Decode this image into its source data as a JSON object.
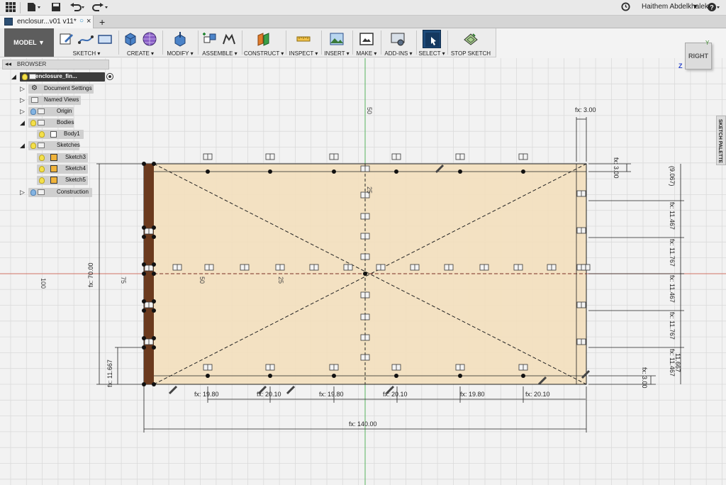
{
  "app": {
    "user_name": "Haithem Abdelkhalek",
    "document_tab": "enclosur...v01 v11*",
    "new_tab": "+",
    "help": "?"
  },
  "icons": {
    "app_grid": "app-grid-icon",
    "file": "file-icon",
    "save": "save-icon",
    "undo": "undo-icon",
    "redo": "redo-icon",
    "clock": "clock-icon",
    "help": "help-icon"
  },
  "toolbar": {
    "workspace": "MODEL",
    "groups": [
      {
        "label": "SKETCH",
        "icons": [
          "sketch-create-icon",
          "spline-icon",
          "rectangle-icon"
        ]
      },
      {
        "label": "CREATE",
        "icons": [
          "box-icon",
          "sphere-icon"
        ]
      },
      {
        "label": "MODIFY",
        "icons": [
          "press-pull-icon"
        ]
      },
      {
        "label": "ASSEMBLE",
        "icons": [
          "new-component-icon",
          "joint-icon"
        ]
      },
      {
        "label": "CONSTRUCT",
        "icons": [
          "offset-plane-icon"
        ]
      },
      {
        "label": "INSPECT",
        "icons": [
          "measure-icon"
        ]
      },
      {
        "label": "INSERT",
        "icons": [
          "insert-image-icon"
        ]
      },
      {
        "label": "MAKE",
        "icons": [
          "3d-print-icon"
        ]
      },
      {
        "label": "ADD-INS",
        "icons": [
          "scripts-icon"
        ]
      },
      {
        "label": "SELECT",
        "icons": [
          "select-icon"
        ]
      },
      {
        "label": "STOP SKETCH",
        "icons": [
          "stop-sketch-icon"
        ]
      }
    ]
  },
  "browser": {
    "title": "BROWSER",
    "nodes": [
      {
        "label": "enclosure_fin...",
        "level": 0
      },
      {
        "label": "Document Settings",
        "level": 1
      },
      {
        "label": "Named Views",
        "level": 1
      },
      {
        "label": "Origin",
        "level": 1
      },
      {
        "label": "Bodies",
        "level": 1
      },
      {
        "label": "Body1",
        "level": 2
      },
      {
        "label": "Sketches",
        "level": 1
      },
      {
        "label": "Sketch3",
        "level": 2
      },
      {
        "label": "Sketch4",
        "level": 2
      },
      {
        "label": "Sketch5",
        "level": 2
      },
      {
        "label": "Construction",
        "level": 1
      }
    ]
  },
  "viewcube": {
    "face": "RIGHT",
    "axis_z": "Z",
    "axis_y": "Y"
  },
  "sketch_palette": {
    "label": "SKETCH PALETTE"
  },
  "dimensions": {
    "top_offset": "fx: 3.00",
    "top_right_offset": "fx: 3.00",
    "bottom_right_offset": "fx: 3.00",
    "overall_width": "fx: 140.00",
    "overall_height": "fx: 70.00",
    "left_bottom": "fx: 11.667",
    "bottom_spacings": [
      "fx: 19.80",
      "fx: 20.10",
      "fx: 19.80",
      "fx: 20.10",
      "fx: 19.80",
      "fx: 20.10"
    ],
    "right_spacings": [
      "(9.067)",
      "fx: 11.467",
      "fx: 11.767",
      "fx: 11.467",
      "fx: 11.767",
      "fx: 11.467"
    ],
    "right_overlap_text": "11.667"
  },
  "grid_labels": {
    "y_top": "50",
    "y_mid": "25",
    "x_left_far": "100",
    "x_left_near": "75",
    "x_50": "50",
    "x_25": "25"
  },
  "colors": {
    "sketch_fill": "#f3dfbd",
    "sketch_stroke": "#222222",
    "body_edge": "#6b3a1e",
    "axis_green": "#3aa047",
    "axis_red": "#c75a4d",
    "grid": "#d9d9d9"
  }
}
